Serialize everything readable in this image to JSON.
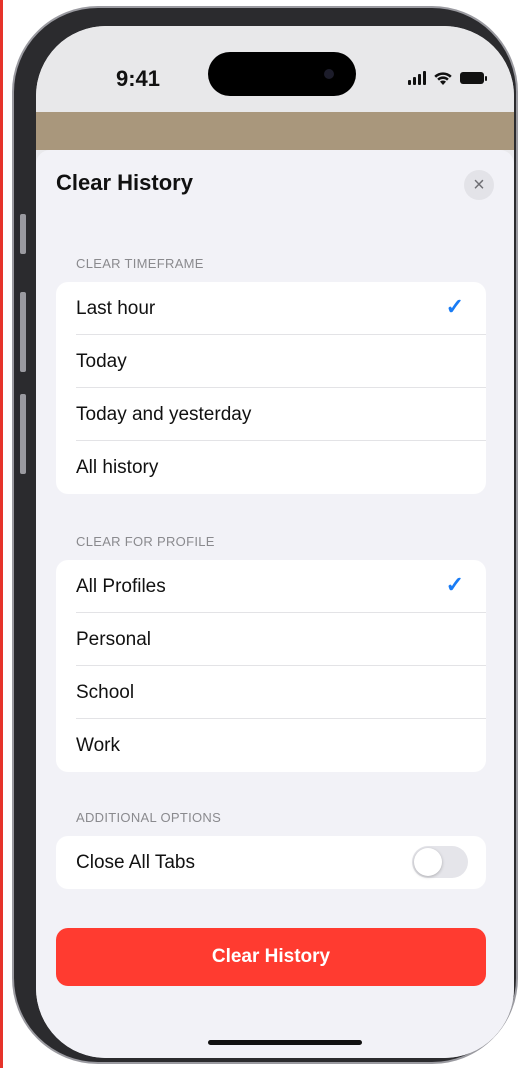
{
  "status_bar": {
    "time": "9:41"
  },
  "sheet": {
    "title": "Clear History",
    "close_icon": "×"
  },
  "timeframe": {
    "header": "CLEAR TIMEFRAME",
    "options": [
      {
        "label": "Last hour",
        "selected": true
      },
      {
        "label": "Today",
        "selected": false
      },
      {
        "label": "Today and yesterday",
        "selected": false
      },
      {
        "label": "All history",
        "selected": false
      }
    ]
  },
  "profile": {
    "header": "CLEAR FOR PROFILE",
    "options": [
      {
        "label": "All Profiles",
        "selected": true
      },
      {
        "label": "Personal",
        "selected": false
      },
      {
        "label": "School",
        "selected": false
      },
      {
        "label": "Work",
        "selected": false
      }
    ]
  },
  "additional": {
    "header": "ADDITIONAL OPTIONS",
    "close_all_tabs": {
      "label": "Close All Tabs",
      "on": false
    }
  },
  "checkmark": "✓",
  "primary_button": {
    "label": "Clear History",
    "color": "#ff3b30"
  },
  "accent_color": "#1a7cf5"
}
